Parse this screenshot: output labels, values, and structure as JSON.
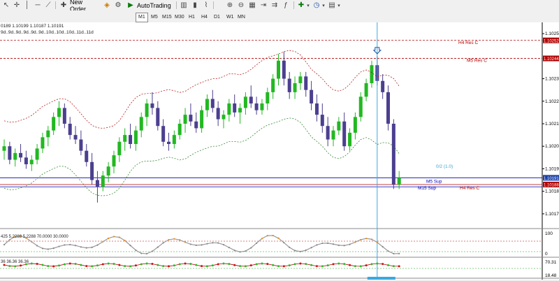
{
  "toolbar": {
    "new_order_label": "New Order",
    "auto_trading_label": "AutoTrading",
    "timeframes": [
      "M1",
      "M5",
      "M15",
      "M30",
      "H1",
      "H4",
      "D1",
      "W1",
      "MN"
    ]
  },
  "chart": {
    "ohlc_text": "0189 1.10199 1.10187 1.10191",
    "indicator_text": "9d..9d..9d..9d..9d..9d..10d..10d..10d..11d..11d",
    "price_axis": {
      "ticks": [
        "1.10255",
        "1.10235",
        "1.10225",
        "1.10215",
        "1.10205",
        "1.10195",
        "1.10185",
        "1.10175"
      ],
      "ymin": 1.1017,
      "ymax": 1.1026,
      "tick_values": [
        1.10255,
        1.10235,
        1.10225,
        1.10215,
        1.10205,
        1.10195,
        1.10185,
        1.10175
      ],
      "current_price_label": "1.10191",
      "current_price": 1.10191,
      "level_labels": [
        {
          "value": 1.10252,
          "text": "1.10252"
        },
        {
          "value": 1.10244,
          "text": "1.10244"
        },
        {
          "value": 1.10188,
          "text": "1.10188"
        }
      ]
    },
    "levels": [
      {
        "name": "H4 Res C",
        "price": 1.10252,
        "label": "H4 Res C",
        "color": "#b00000",
        "dash": true
      },
      {
        "name": "M5 Res C",
        "price": 1.10244,
        "label": "M5 Res C",
        "color": "#b00000",
        "dash": true
      },
      {
        "name": "M5 Sup",
        "price": 1.10191,
        "label": "M5 Sup",
        "color": "#0000b0",
        "dash": false
      },
      {
        "name": "H4 Res C2",
        "price": 1.10188,
        "label": "H4 Res C",
        "color": "#b00000",
        "dash": false
      },
      {
        "name": "M15 Sup",
        "price": 1.10187,
        "label": "M15 Sup",
        "color": "#0000b0",
        "dash": false
      }
    ],
    "fib_label": "0/2 (1.0)",
    "osc1_text": "425 5.2288 5.2288 70.0000 30.0000",
    "osc1_axis": [
      "100",
      "0"
    ],
    "osc2_text": "36 36.36 36.36",
    "osc2_axis": [
      "70.31",
      "18.48"
    ]
  },
  "chart_data": {
    "type": "candlestick",
    "candles": [
      [
        1.10203,
        1.10208,
        1.10199,
        1.10205
      ],
      [
        1.10205,
        1.10207,
        1.10197,
        1.10199
      ],
      [
        1.10199,
        1.10204,
        1.10196,
        1.10202
      ],
      [
        1.10202,
        1.10206,
        1.10198,
        1.102
      ],
      [
        1.102,
        1.10203,
        1.10195,
        1.10197
      ],
      [
        1.10197,
        1.10201,
        1.10194,
        1.10199
      ],
      [
        1.10199,
        1.10206,
        1.10197,
        1.10204
      ],
      [
        1.10204,
        1.10211,
        1.10202,
        1.10209
      ],
      [
        1.10209,
        1.10214,
        1.10205,
        1.10212
      ],
      [
        1.10212,
        1.1022,
        1.1021,
        1.10218
      ],
      [
        1.10218,
        1.10225,
        1.10214,
        1.10222
      ],
      [
        1.10222,
        1.10224,
        1.10213,
        1.10215
      ],
      [
        1.10215,
        1.10218,
        1.10208,
        1.1021
      ],
      [
        1.1021,
        1.10214,
        1.10206,
        1.10208
      ],
      [
        1.10208,
        1.10212,
        1.10201,
        1.10203
      ],
      [
        1.10203,
        1.10206,
        1.10196,
        1.10198
      ],
      [
        1.10198,
        1.10202,
        1.10188,
        1.1019
      ],
      [
        1.1019,
        1.10194,
        1.1018,
        1.10187
      ],
      [
        1.10187,
        1.10194,
        1.10185,
        1.10192
      ],
      [
        1.10192,
        1.10198,
        1.10189,
        1.10196
      ],
      [
        1.10196,
        1.10203,
        1.10193,
        1.10201
      ],
      [
        1.10201,
        1.10209,
        1.10198,
        1.10207
      ],
      [
        1.10207,
        1.10213,
        1.10203,
        1.1021
      ],
      [
        1.1021,
        1.10215,
        1.10204,
        1.10206
      ],
      [
        1.10206,
        1.10214,
        1.10203,
        1.10212
      ],
      [
        1.10212,
        1.1022,
        1.10209,
        1.10218
      ],
      [
        1.10218,
        1.10226,
        1.10214,
        1.10224
      ],
      [
        1.10224,
        1.10229,
        1.10219,
        1.10222
      ],
      [
        1.10222,
        1.10225,
        1.10212,
        1.10214
      ],
      [
        1.10214,
        1.10217,
        1.10205,
        1.10207
      ],
      [
        1.10207,
        1.10211,
        1.10203,
        1.10206
      ],
      [
        1.10206,
        1.10212,
        1.10204,
        1.1021
      ],
      [
        1.1021,
        1.10217,
        1.10208,
        1.10215
      ],
      [
        1.10215,
        1.10222,
        1.10211,
        1.10219
      ],
      [
        1.10219,
        1.10224,
        1.10214,
        1.10216
      ],
      [
        1.10216,
        1.1022,
        1.10211,
        1.10213
      ],
      [
        1.10213,
        1.10223,
        1.10211,
        1.10221
      ],
      [
        1.10221,
        1.10228,
        1.10218,
        1.10226
      ],
      [
        1.10226,
        1.1023,
        1.1022,
        1.10222
      ],
      [
        1.10222,
        1.10225,
        1.10214,
        1.10217
      ],
      [
        1.10217,
        1.10221,
        1.10213,
        1.10219
      ],
      [
        1.10219,
        1.10226,
        1.10216,
        1.10224
      ],
      [
        1.10224,
        1.10228,
        1.10218,
        1.1022
      ],
      [
        1.1022,
        1.10224,
        1.10215,
        1.10222
      ],
      [
        1.10222,
        1.10229,
        1.10219,
        1.10227
      ],
      [
        1.10227,
        1.10232,
        1.10222,
        1.10224
      ],
      [
        1.10224,
        1.10227,
        1.10219,
        1.10221
      ],
      [
        1.10221,
        1.10226,
        1.10219,
        1.10224
      ],
      [
        1.10224,
        1.10231,
        1.10221,
        1.10229
      ],
      [
        1.10229,
        1.10237,
        1.10226,
        1.10235
      ],
      [
        1.10235,
        1.10246,
        1.10232,
        1.10243
      ],
      [
        1.10243,
        1.10247,
        1.10232,
        1.10235
      ],
      [
        1.10235,
        1.10238,
        1.10226,
        1.10229
      ],
      [
        1.10229,
        1.10236,
        1.10226,
        1.10233
      ],
      [
        1.10233,
        1.10238,
        1.1023,
        1.10236
      ],
      [
        1.10236,
        1.10238,
        1.10227,
        1.1023
      ],
      [
        1.1023,
        1.10234,
        1.10221,
        1.10224
      ],
      [
        1.10224,
        1.10228,
        1.10216,
        1.10219
      ],
      [
        1.10219,
        1.10224,
        1.10211,
        1.10214
      ],
      [
        1.10214,
        1.10218,
        1.10205,
        1.10208
      ],
      [
        1.10208,
        1.10214,
        1.10205,
        1.10212
      ],
      [
        1.10212,
        1.10218,
        1.1021,
        1.10216
      ],
      [
        1.10216,
        1.1022,
        1.10203,
        1.10205
      ],
      [
        1.10205,
        1.10213,
        1.10203,
        1.10211
      ],
      [
        1.10211,
        1.1022,
        1.10208,
        1.10218
      ],
      [
        1.10218,
        1.10229,
        1.10216,
        1.10227
      ],
      [
        1.10227,
        1.10235,
        1.10225,
        1.10233
      ],
      [
        1.10233,
        1.10243,
        1.10231,
        1.10241
      ],
      [
        1.10241,
        1.10245,
        1.10232,
        1.10234
      ],
      [
        1.10234,
        1.10237,
        1.10226,
        1.10229
      ],
      [
        1.10229,
        1.10232,
        1.10212,
        1.10215
      ],
      [
        1.10215,
        1.10217,
        1.10186,
        1.10188
      ],
      [
        1.10188,
        1.10194,
        1.10186,
        1.10191
      ]
    ]
  }
}
